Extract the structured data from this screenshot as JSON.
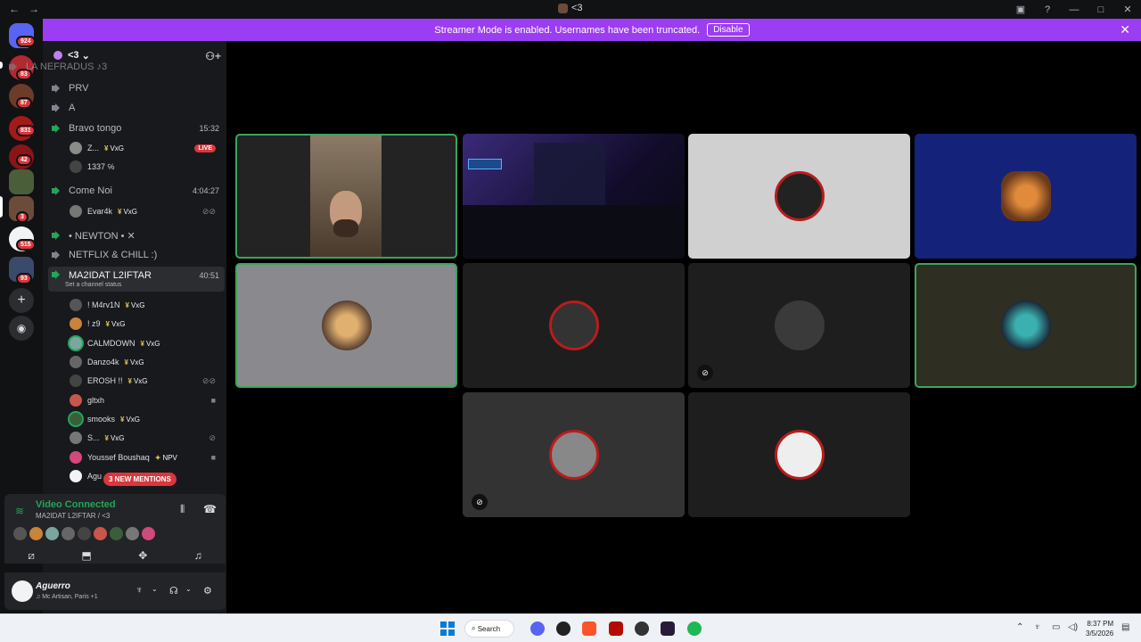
{
  "titlebar": {
    "back": "←",
    "forward": "→",
    "title": "<3"
  },
  "banner": {
    "message": "Streamer Mode is enabled. Usernames have been truncated.",
    "disable_label": "Disable"
  },
  "servers": {
    "home_badge": "924",
    "badges": [
      "83",
      "87",
      "831",
      "42",
      "3",
      "515",
      "93"
    ]
  },
  "channel_sidebar": {
    "server_name": "<3",
    "partial_channel": "LA NEFRADUS  ♪3",
    "channels": {
      "prv": "PRV",
      "a": "A",
      "bravo": {
        "name": "Bravo tongo",
        "time": "15:32"
      },
      "come_noi": {
        "name": "Come Noi",
        "time": "4:04:27"
      },
      "newton": "• NEWTON • ✕",
      "netflix": "NETFLIX & CHILL :)",
      "ma2idat": {
        "name": "MA2IDAT L2IFTAR",
        "time": "40:51",
        "status": "Set a channel status"
      }
    },
    "bravo_members": [
      {
        "name": "Z...",
        "tag": "VxG",
        "live": "LIVE"
      },
      {
        "name": "1337 ℅"
      }
    ],
    "come_noi_members": [
      {
        "name": "Evar4k",
        "tag": "VxG"
      }
    ],
    "ma2idat_members": [
      {
        "name": "! M4rv1N",
        "tag": "VxG"
      },
      {
        "name": "! z9",
        "tag": "VxG"
      },
      {
        "name": "CALMDOWN",
        "tag": "VxG"
      },
      {
        "name": "Danzo4k",
        "tag": "VxG"
      },
      {
        "name": "EROSH !!",
        "tag": "VxG"
      },
      {
        "name": "gltxh"
      },
      {
        "name": "smooks",
        "tag": "VxG"
      },
      {
        "name": "S...",
        "tag": "VxG"
      },
      {
        "name": "Youssef Boushaq",
        "tag": "NPV"
      },
      {
        "name": "Agu"
      }
    ],
    "mentions": "3 NEW MENTIONS"
  },
  "voice_panel": {
    "status": "Video Connected",
    "channel": "MA2IDAT L2IFTAR / <3"
  },
  "user": {
    "name": "Aguerro",
    "status": "♫ Mc Artisan, Paris +1"
  },
  "taskbar": {
    "search": "Search",
    "time": "8:37 PM",
    "date": "3/5/2026"
  },
  "colors": {
    "accent": "#9b3df3",
    "speaking": "#3ba55d",
    "danger": "#da373c"
  }
}
